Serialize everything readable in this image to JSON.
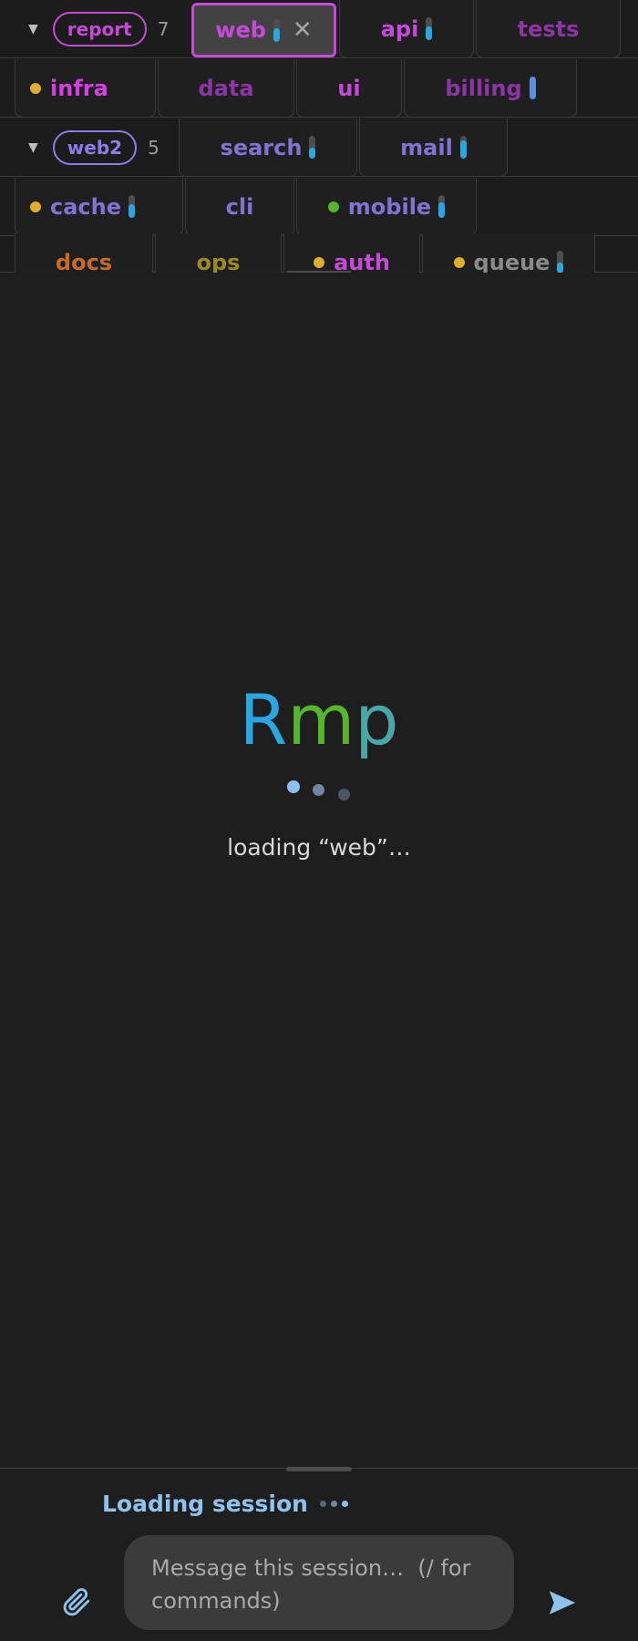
{
  "tabbar": {
    "group1": {
      "label": "report",
      "count": "7",
      "color": "#c64ad9"
    },
    "group2": {
      "label": "web2",
      "count": "5",
      "color": "#8a7ee8"
    },
    "row1": [
      {
        "label": "web",
        "color": "#c64ad9",
        "active": true,
        "activity": "bar",
        "bar_fill": 0.6,
        "closable": true
      },
      {
        "label": "api",
        "color": "#c64ad9",
        "activity": "bar",
        "bar_fill": 0.6
      },
      {
        "label": "tests",
        "color": "#8e35a5"
      }
    ],
    "row2": [
      {
        "label": "infra",
        "color": "#d53fe3",
        "dot": "#e0ad2c"
      },
      {
        "label": "data",
        "color": "#8e35a5"
      },
      {
        "label": "ui",
        "color": "#c64ad9"
      },
      {
        "label": "billing",
        "color": "#8e35a5",
        "activity": "bar",
        "bar_fill": 1.0
      }
    ],
    "row3": [
      {
        "label": "search",
        "color": "#7f74d4",
        "activity": "bar",
        "bar_fill": 0.5
      },
      {
        "label": "mail",
        "color": "#7f74d4",
        "activity": "bar",
        "bar_fill": 0.8
      }
    ],
    "row4": [
      {
        "label": "cache",
        "color": "#7f74d4",
        "dot": "#e0ad2c",
        "activity": "bar",
        "bar_fill": 0.6
      },
      {
        "label": "cli",
        "color": "#7f74d4"
      },
      {
        "label": "mobile",
        "color": "#7f74d4",
        "dot": "#56b52a",
        "activity": "bar",
        "bar_fill": 0.7
      }
    ],
    "row5": [
      {
        "label": "docs",
        "color": "#c86a2a"
      },
      {
        "label": "ops",
        "color": "#9a8a25"
      },
      {
        "label": "auth",
        "color": "#c64ad9",
        "dot": "#e0ad2c"
      },
      {
        "label": "queue",
        "color": "#8a8a8a",
        "dot": "#e0ad2c",
        "activity": "bar",
        "bar_fill": 0.5
      }
    ],
    "bar_color": "#2aa7e0"
  },
  "loading": {
    "logo": [
      {
        "char": "R",
        "color": "#2aa7e0"
      },
      {
        "char": "m",
        "color": "#56b52a"
      },
      {
        "char": "p",
        "color": "#4aa7a7"
      }
    ],
    "message": "loading “web”…",
    "dot_colors": [
      "#8ac1ef",
      "#6f87a3",
      "#4b5663"
    ]
  },
  "footer": {
    "status": "Loading session",
    "status_dot_colors": [
      "#5a6675",
      "#6f87a3",
      "#8ac1ef"
    ],
    "input_placeholder": "Message this session…  (/ for commands)",
    "accent": "#8fc3ee"
  }
}
